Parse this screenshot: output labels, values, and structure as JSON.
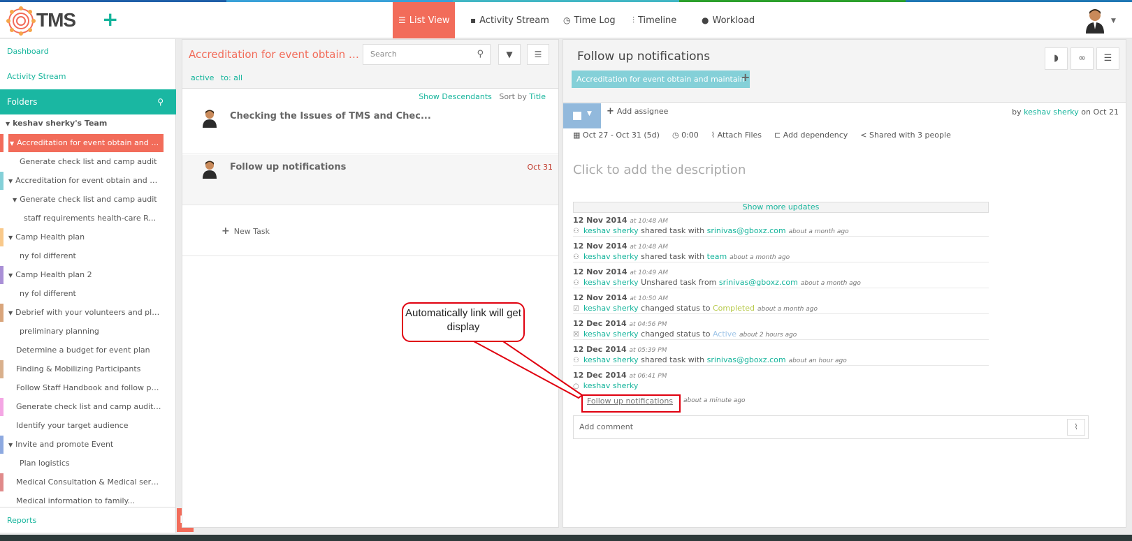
{
  "app": {
    "name": "TMS"
  },
  "colors": {
    "accent": "#14b49b",
    "active_nav": "#f26c5a",
    "tag": "#84d0d8",
    "callout": "#e0000f"
  },
  "nav": [
    {
      "label": "List View",
      "icon": "list-icon",
      "active": true
    },
    {
      "label": "Activity Stream",
      "icon": "comment-icon",
      "active": false
    },
    {
      "label": "Time Log",
      "icon": "clock-icon",
      "active": false
    },
    {
      "label": "Timeline",
      "icon": "timeline-icon",
      "active": false
    },
    {
      "label": "Workload",
      "icon": "user-icon",
      "active": false
    }
  ],
  "sidebar": {
    "dashboard": "Dashboard",
    "activity_stream": "Activity Stream",
    "folders": "Folders",
    "team": "keshav sherky's Team",
    "reports": "Reports",
    "items": [
      {
        "label": "Accreditation for event obtain and mai...",
        "color": "#f26c5a",
        "selected": true
      },
      {
        "label": "Generate check list and camp audit"
      },
      {
        "label": "Accreditation for event obtain and mai...",
        "color": "#84d0d8"
      },
      {
        "label": "Generate check list and camp audit"
      },
      {
        "label": "staff requirements health-care Resp..."
      },
      {
        "label": "Camp Health plan",
        "color": "#f9c98a"
      },
      {
        "label": "ny fol different"
      },
      {
        "label": "Camp Health plan 2",
        "color": "#a98fd6"
      },
      {
        "label": "ny fol different"
      },
      {
        "label": "Debrief with your volunteers and plan...",
        "color": "#d9a57b"
      },
      {
        "label": "preliminary planning"
      },
      {
        "label": "Determine a budget for event plan"
      },
      {
        "label": "Finding & Mobilizing Participants",
        "color": "#d9b08c"
      },
      {
        "label": "Follow Staff Handbook and follow poli..."
      },
      {
        "label": "Generate check list and camp audit He...",
        "color": "#f4a6e4"
      },
      {
        "label": "Identify your target audience"
      },
      {
        "label": "Invite and promote Event",
        "color": "#8da9e0"
      },
      {
        "label": "Plan logistics"
      },
      {
        "label": "Medical Consultation & Medical service...",
        "color": "#e08a8a"
      },
      {
        "label": "Medical information to family..."
      }
    ]
  },
  "list": {
    "title": "Accreditation for event obtain and ma...",
    "search_placeholder": "Search",
    "filter_active": "active",
    "filter_to": "to: all",
    "show_descendants": "Show Descendants",
    "sort_by": "Sort by",
    "sort_field": "Title",
    "tasks": [
      {
        "name": "Checking the Issues of TMS and Chec...",
        "date": ""
      },
      {
        "name": "Follow up notifications",
        "date": "Oct 31"
      }
    ],
    "new_task": "New Task"
  },
  "detail": {
    "title": "Follow up notifications",
    "tag": "Accreditation for event obtain and maintain",
    "add_assignee": "Add assignee",
    "by": "by",
    "author": "keshav sherky",
    "on": "on Oct 21",
    "dates": "Oct 27 - Oct 31 (5d)",
    "time": "0:00",
    "attach": "Attach Files",
    "dependency": "Add dependency",
    "shared": "Shared with 3 people",
    "description_placeholder": "Click to add the description",
    "show_more": "Show more updates",
    "updates": [
      {
        "date": "12 Nov 2014",
        "time": "at 10:48 AM",
        "user": "keshav sherky",
        "action": "shared task with",
        "target": "srinivas@gboxz.com",
        "ago": "about a month ago"
      },
      {
        "date": "12 Nov 2014",
        "time": "at 10:48 AM",
        "user": "keshav sherky",
        "action": "shared task with",
        "target": "team",
        "ago": "about a month ago"
      },
      {
        "date": "12 Nov 2014",
        "time": "at 10:49 AM",
        "user": "keshav sherky",
        "action": "Unshared task from",
        "target": "srinivas@gboxz.com",
        "ago": "about a month ago"
      },
      {
        "date": "12 Nov 2014",
        "time": "at 10:50 AM",
        "user": "keshav sherky",
        "action": "changed status to",
        "target": "Completed",
        "ago": "about a month ago"
      },
      {
        "date": "12 Dec 2014",
        "time": "at 04:56 PM",
        "user": "keshav sherky",
        "action": "changed status to",
        "target": "Active",
        "ago": "about 2 hours ago"
      },
      {
        "date": "12 Dec 2014",
        "time": "at 05:39 PM",
        "user": "keshav sherky",
        "action": "shared task with",
        "target": "srinivas@gboxz.com",
        "ago": "about an hour ago"
      },
      {
        "date": "12 Dec 2014",
        "time": "at 06:41 PM",
        "user": "keshav sherky",
        "action": "",
        "target": "",
        "ago": ""
      }
    ],
    "comment_link": "Follow up notifications",
    "comment_ago": "about a minute ago",
    "add_comment": "Add comment"
  },
  "callout": {
    "text": "Automatically link will get display"
  }
}
